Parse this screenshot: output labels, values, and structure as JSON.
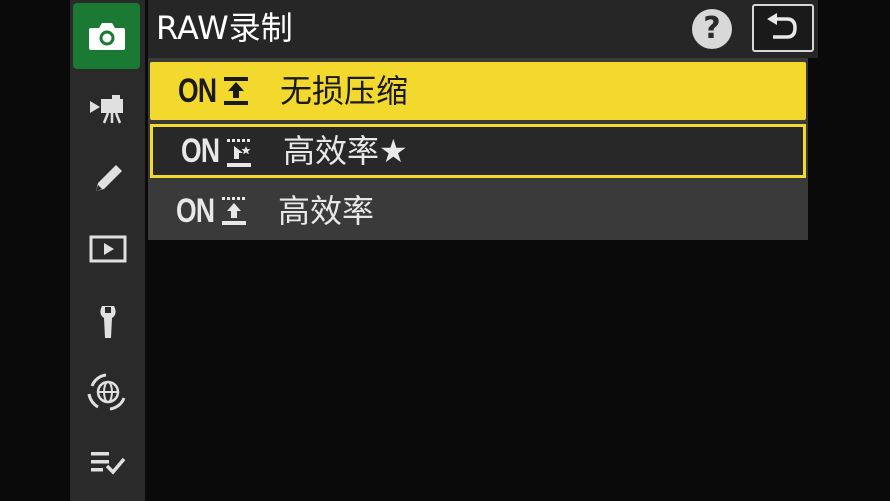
{
  "header": {
    "title": "RAW录制",
    "help_label": "?",
    "back_icon": "return-arrow-icon"
  },
  "sidebar": {
    "items": [
      {
        "icon": "camera-icon",
        "active": true
      },
      {
        "icon": "movie-camera-icon",
        "active": false
      },
      {
        "icon": "pencil-icon",
        "active": false
      },
      {
        "icon": "playback-icon",
        "active": false
      },
      {
        "icon": "wrench-icon",
        "active": false
      },
      {
        "icon": "network-globe-icon",
        "active": false
      },
      {
        "icon": "my-menu-check-icon",
        "active": false
      }
    ]
  },
  "options": [
    {
      "on": "ON",
      "icon": "lossless-compressed-icon",
      "label": "无损压缩",
      "state": "highlighted"
    },
    {
      "on": "ON",
      "icon": "high-efficiency-star-icon",
      "label": "高效率★",
      "state": "selected"
    },
    {
      "on": "ON",
      "icon": "high-efficiency-icon",
      "label": "高效率",
      "state": "normal"
    }
  ],
  "colors": {
    "highlight": "#f3d92e",
    "active_tab": "#1a7a33",
    "sidebar": "#2a2a2a",
    "list_bg": "#3a3a3a"
  }
}
